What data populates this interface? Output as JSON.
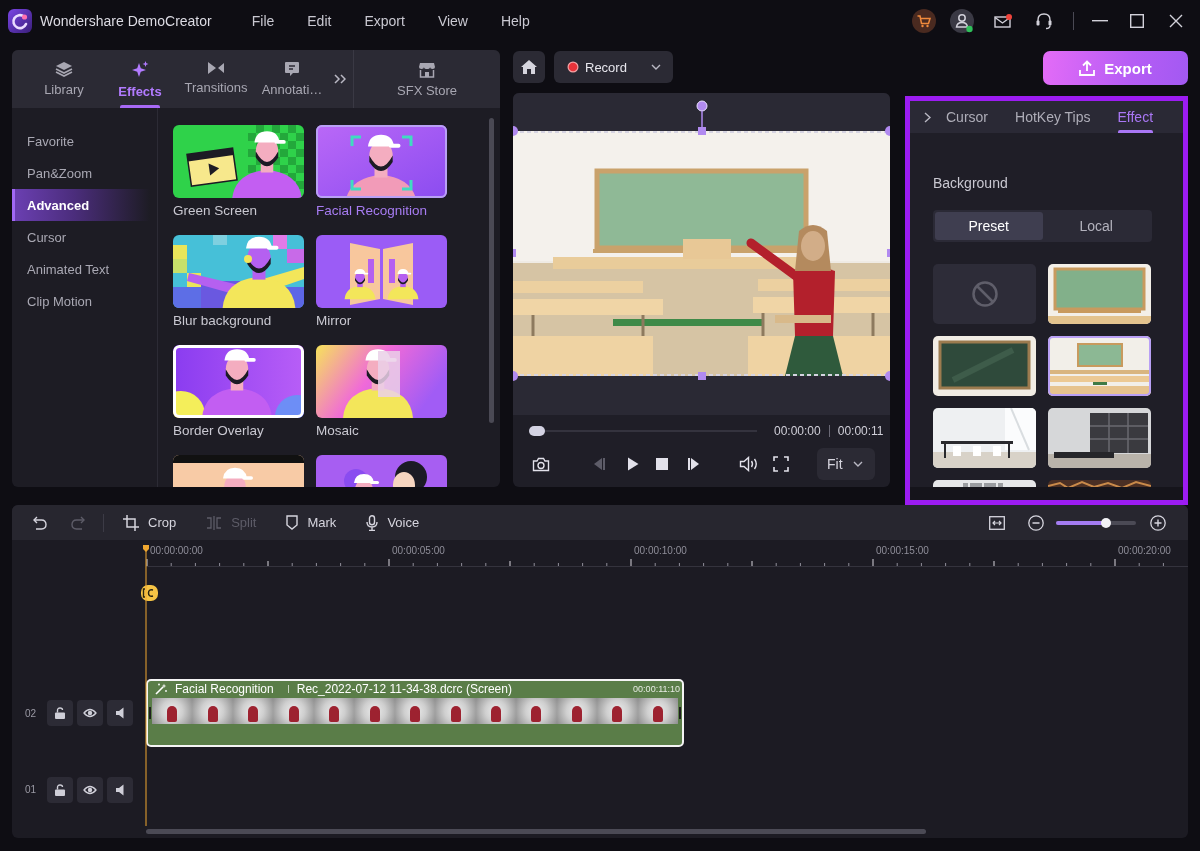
{
  "window": {
    "title": "Wondershare DemoCreator",
    "menu": [
      "File",
      "Edit",
      "Export",
      "View",
      "Help"
    ]
  },
  "media_tabs": [
    {
      "label": "Library",
      "selected": false
    },
    {
      "label": "Effects",
      "selected": true
    },
    {
      "label": "Transitions",
      "selected": false
    },
    {
      "label": "Annotati…",
      "selected": false
    }
  ],
  "store_tab": {
    "label": "SFX Store"
  },
  "effect_categories": [
    {
      "label": "Favorite",
      "selected": false
    },
    {
      "label": "Pan&Zoom",
      "selected": false
    },
    {
      "label": "Advanced",
      "selected": true
    },
    {
      "label": "Cursor",
      "selected": false
    },
    {
      "label": "Animated Text",
      "selected": false
    },
    {
      "label": "Clip Motion",
      "selected": false
    }
  ],
  "effects": [
    {
      "kind": "green-screen",
      "label": "Green Screen",
      "selected": false
    },
    {
      "kind": "facial-recognition",
      "label": "Facial Recognition",
      "selected": true
    },
    {
      "kind": "blur-background",
      "label": "Blur background",
      "selected": false
    },
    {
      "kind": "mirror",
      "label": "Mirror",
      "selected": false
    },
    {
      "kind": "border-overlay",
      "label": "Border Overlay",
      "selected": false
    },
    {
      "kind": "mosaic",
      "label": "Mosaic",
      "selected": false
    },
    {
      "kind": "portrait",
      "selected": false
    },
    {
      "kind": "group",
      "selected": false
    }
  ],
  "record_button": {
    "label": "Record"
  },
  "export_button": {
    "label": "Export"
  },
  "preview": {
    "progress": {
      "level": 0
    },
    "current_time": "00:00:00",
    "duration": "00:00:11",
    "controls": [
      {
        "kind": "snapshot",
        "disabled": false
      },
      {
        "kind": "previous-frame",
        "disabled": true
      },
      {
        "kind": "play",
        "disabled": false
      },
      {
        "kind": "stop",
        "disabled": false
      },
      {
        "kind": "next-frame",
        "disabled": false
      },
      {
        "kind": "volume",
        "disabled": false
      },
      {
        "kind": "fullscreen",
        "disabled": false
      }
    ],
    "zoom_menu": {
      "value": "Fit"
    }
  },
  "properties_panel": {
    "tabs": [
      {
        "label": "Cursor",
        "selected": false
      },
      {
        "label": "HotKey Tips",
        "selected": false
      },
      {
        "label": "Effect",
        "selected": true
      }
    ],
    "section_title": "Background",
    "source_tabs": [
      {
        "label": "Preset",
        "selected": true
      },
      {
        "label": "Local",
        "selected": false
      }
    ],
    "backgrounds": [
      {
        "kind": "none",
        "selected": false
      },
      {
        "kind": "green-chalkboard",
        "selected": false
      },
      {
        "kind": "dark-chalkboard",
        "selected": false
      },
      {
        "kind": "classroom",
        "selected": true
      },
      {
        "kind": "white-room",
        "selected": false
      },
      {
        "kind": "shelf-room",
        "selected": false
      },
      {
        "kind": "office",
        "selected": false
      },
      {
        "kind": "dark-room",
        "selected": false
      }
    ]
  },
  "timeline": {
    "tools": [
      {
        "kind": "undo",
        "disabled": false
      },
      {
        "kind": "redo",
        "disabled": true
      },
      {
        "kind": "crop",
        "label": "Crop",
        "disabled": false
      },
      {
        "kind": "split",
        "label": "Split",
        "disabled": true
      },
      {
        "kind": "mark",
        "label": "Mark",
        "disabled": false
      },
      {
        "kind": "voice",
        "label": "Voice",
        "disabled": false
      }
    ],
    "zoom": {
      "level": 0.62
    },
    "ruler": [
      "00:00:00:00",
      "00:00:05:00",
      "00:00:10:00",
      "00:00:15:00",
      "00:00:20:00"
    ],
    "tracks": [
      {
        "number": "02",
        "clip": {
          "effect": "Facial Recognition",
          "source": "Rec_2022-07-12 11-34-38.dcrc (Screen)",
          "duration": "00:00:11:10",
          "selected": true
        }
      },
      {
        "number": "01"
      }
    ]
  }
}
